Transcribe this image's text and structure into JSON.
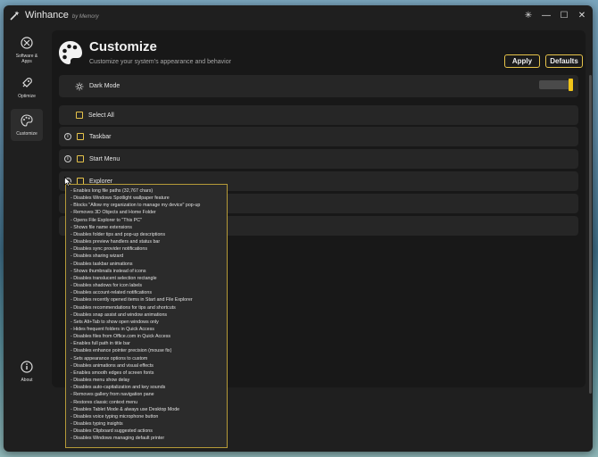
{
  "app": {
    "title": "Winhance",
    "subtitle": "by Memory"
  },
  "window_controls": {
    "theme": "✳",
    "minimize": "—",
    "maximize": "☐",
    "close": "✕"
  },
  "sidebar": {
    "items": [
      {
        "label": "Software & Apps",
        "icon": "apps-icon"
      },
      {
        "label": "Optimize",
        "icon": "rocket-icon"
      },
      {
        "label": "Customize",
        "icon": "palette-icon",
        "active": true
      }
    ],
    "about": {
      "label": "About",
      "icon": "info-icon"
    }
  },
  "header": {
    "title": "Customize",
    "subtitle": "Customize your system's appearance and behavior",
    "apply_label": "Apply",
    "defaults_label": "Defaults"
  },
  "rows": {
    "dark_mode": {
      "label": "Dark Mode",
      "enabled": true
    },
    "select_all": {
      "label": "Select All"
    },
    "taskbar": {
      "label": "Taskbar"
    },
    "start_menu": {
      "label": "Start Menu"
    },
    "explorer": {
      "label": "Explorer"
    }
  },
  "info_glyph": "i",
  "tooltip": {
    "lines": [
      "- Enables long file paths (32,767 chars)",
      "- Disables Windows Spotlight wallpaper feature",
      "- Blocks \"Allow my organization to manage my device\" pop-up",
      "- Removes 3D Objects and Home Folder",
      "- Opens File Explorer to \"This PC\"",
      "- Shows file name extensions",
      "- Disables folder tips and pop-up descriptions",
      "- Disables preview handlers and status bar",
      "- Disables sync provider notifications",
      "- Disables sharing wizard",
      "- Disables taskbar animations",
      "- Shows thumbnails instead of icons",
      "- Disables translucent selection rectangle",
      "- Disables shadows for icon labels",
      "- Disables account-related notifications",
      "- Disables recently opened items in Start and File Explorer",
      "- Disables recommendations for tips and shortcuts",
      "- Disables snap assist and window animations",
      "- Sets Alt+Tab to show open windows only",
      "- Hides frequent folders in Quick Access",
      "- Disables files from Office.com in Quick Access",
      "- Enables full path in title bar",
      "- Disables enhance pointer precision (mouse fix)",
      "- Sets appearance options to custom",
      "- Disables animations and visual effects",
      "- Enables smooth edges of screen fonts",
      "- Disables menu show delay",
      "- Disables auto-capitalization and key sounds",
      "- Removes gallery from navigation pane",
      "- Restores classic context menu",
      "- Disables Tablet Mode & always use Desktop Mode",
      "- Disables voice typing microphone button",
      "- Disables typing insights",
      "- Disables Clipboard suggested actions",
      "- Disables Windows managing default printer"
    ]
  },
  "colors": {
    "accent": "#e6c34a",
    "toggle_knob": "#f0c419",
    "background": "#1f1f1f"
  }
}
